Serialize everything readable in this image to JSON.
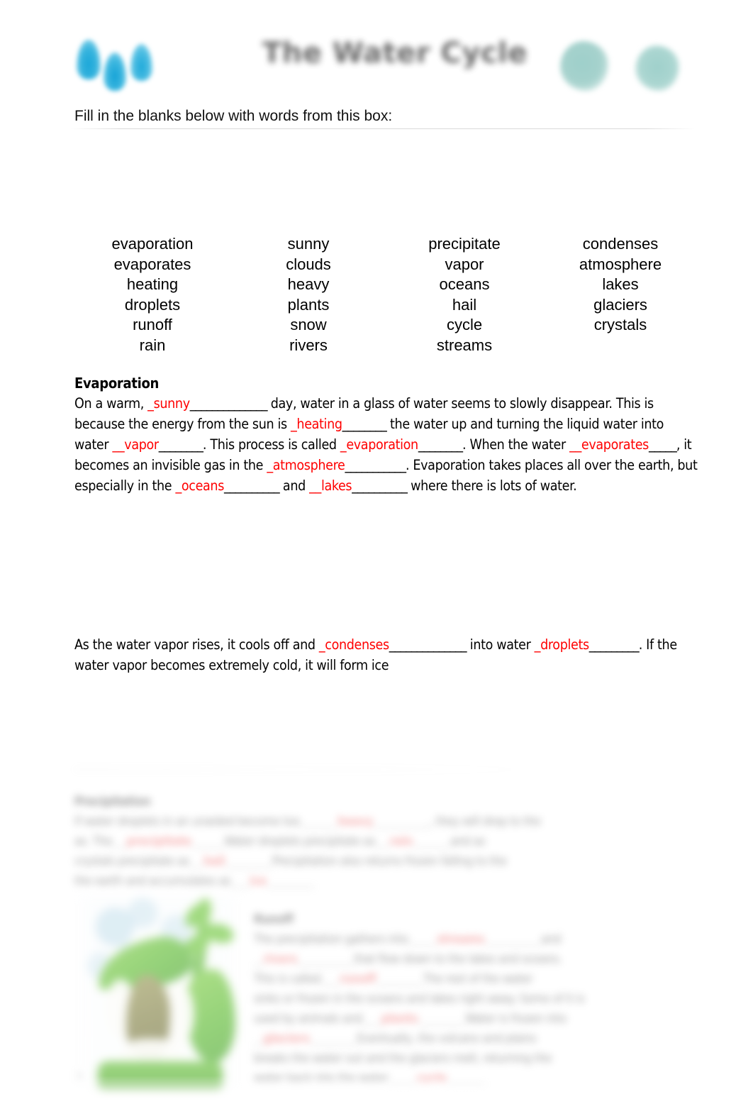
{
  "header": {
    "title": "The Water Cycle",
    "left_icon": "water-droplets",
    "right_icon": "teal-circles"
  },
  "instruction": "Fill in the blanks below with words from this box:",
  "word_bank": {
    "columns": [
      [
        "evaporation",
        "evaporates",
        "heating",
        "droplets",
        "runoff",
        "rain"
      ],
      [
        "sunny",
        "clouds",
        "heavy",
        "plants",
        "snow",
        "rivers"
      ],
      [
        "precipitate",
        "vapor",
        "oceans",
        "hail",
        "cycle",
        "streams"
      ],
      [
        "condenses",
        "atmosphere",
        "lakes",
        "glaciers",
        "crystals"
      ]
    ]
  },
  "evaporation": {
    "heading": "Evaporation",
    "t1": "On a warm, ",
    "a1": "_sunny",
    "b1": "______________",
    "t2": " day, water in a glass of water seems to slowly disappear. This is because the energy from the sun is ",
    "a2": "_heating",
    "b2": "________",
    "t3": " the water up and turning the liquid water into water ",
    "a3": "__vapor",
    "b3": "________",
    "t4": ". This process is called ",
    "a4": "_evaporation",
    "b4": "________",
    "t5": ". When the water ",
    "a5": "__evaporates",
    "b5": "_____",
    "t6": ", it becomes an invisible gas in the ",
    "a6": "_atmosphere",
    "b6": "___________",
    "t7": ". Evaporation takes places all over the earth, but especially in the ",
    "a7": "_oceans",
    "b7": "__________",
    "t8": " and ",
    "a8": "__lakes",
    "b8": "__________",
    "t9": " where there is lots of water."
  },
  "condensation": {
    "t1": "As the water vapor rises, it cools off and ",
    "a1": "_condenses",
    "b1": "______________",
    "t2": " into water ",
    "a2": "_droplets",
    "b2": "_________",
    "t3": ". If the water vapor becomes extremely cold, it will form ice"
  },
  "blurred_lower": {
    "precipitation_heading": "Precipitation",
    "p_line1_a": "If water droplets in an unaided become too",
    "p_line1_ans": "heavy",
    "p_line1_b": ", they will drop to the",
    "p_line2_a": "as. The",
    "p_line2_ans": "precipitate",
    "p_line2_b": "Water droplets precipitate as",
    "p_line2_ans2": "rain",
    "p_line2_c": "and as",
    "p_line3_a": "crystals precipitate as",
    "p_line3_ans": "hail",
    "p_line3_b": "Precipitation also returns frozen falling to the",
    "p_line4_a": "the earth and accumulates as",
    "p_line4_ans": "ice",
    "runoff_heading": "Runoff",
    "r_line1_a": "The precipitation gathers into",
    "r_line1_ans": "streams",
    "r_line1_b": "and",
    "r_line2_ans": "rivers",
    "r_line2_b": "that flow down to the lakes and oceans.",
    "r_line3_a": "This is called",
    "r_line3_ans": "runoff",
    "r_line3_b": "The rest of the water",
    "r_line4": "sinks or frozen in the oceans and lakes right away. Some of it is",
    "r_line5_a": "used by animals and",
    "r_line5_ans": "plants",
    "r_line5_b": "Water is frozen into",
    "r_line6_ans": "glaciers",
    "r_line6_b": "Eventually, the volcano and plains",
    "r_line7": "breaks the water out and the glaciers melt, returning the",
    "r_line8_a": "water back into the water",
    "r_line8_ans": "cycle",
    "plant_image": "plant-sprout-clipart",
    "page_number": "1"
  }
}
